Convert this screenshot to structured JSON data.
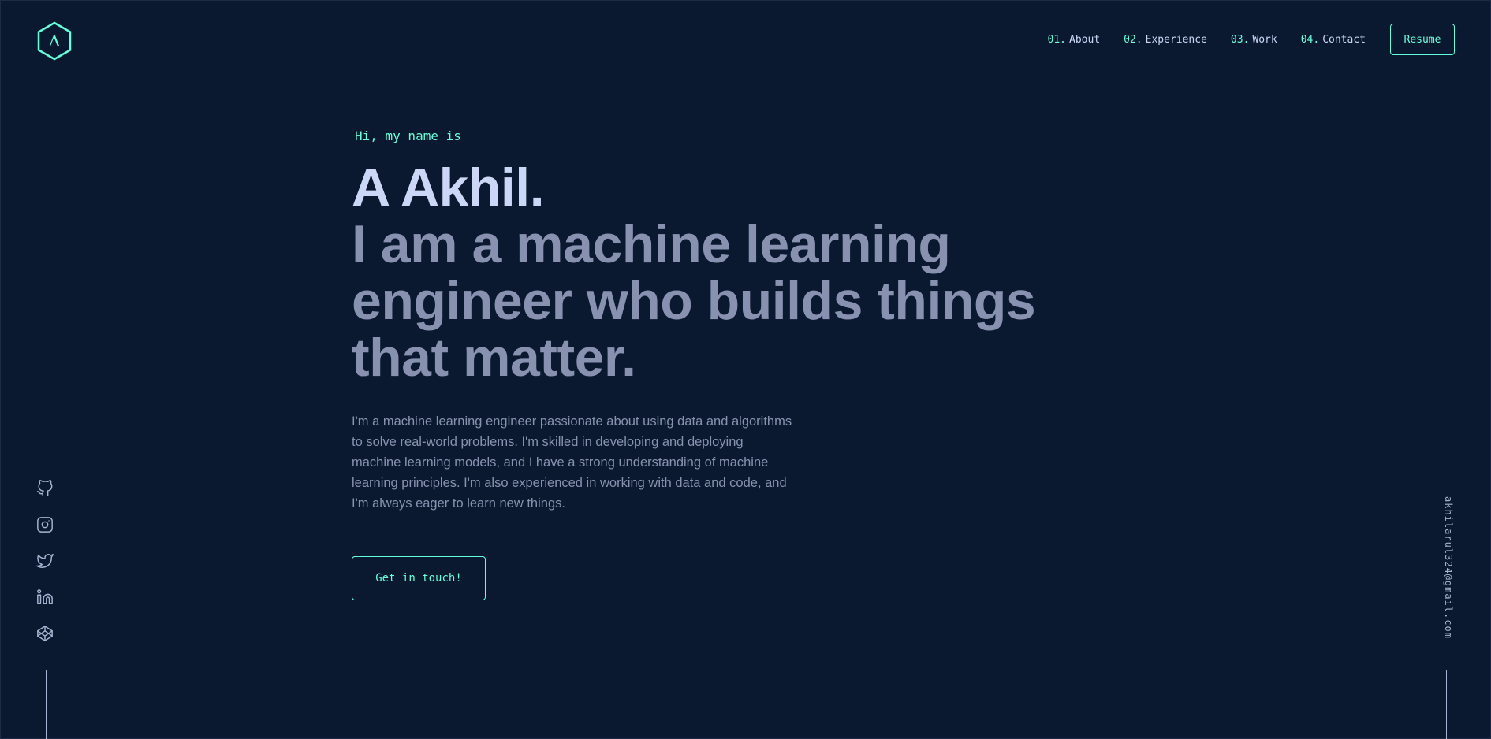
{
  "header": {
    "logo_letter": "A",
    "logo_icon": "hexagon-logo-icon",
    "nav": [
      {
        "num": "01.",
        "label": "About"
      },
      {
        "num": "02.",
        "label": "Experience"
      },
      {
        "num": "03.",
        "label": "Work"
      },
      {
        "num": "04.",
        "label": "Contact"
      }
    ],
    "resume_label": "Resume"
  },
  "hero": {
    "greeting": "Hi, my name is",
    "name": "A Akhil.",
    "tagline": "I am a machine learning engineer who builds things that matter.",
    "bio": "I'm a machine learning engineer passionate about using data and algorithms to solve real-world problems. I'm skilled in developing and deploying machine learning models, and I have a strong understanding of machine learning principles. I'm also experienced in working with data and code, and I'm always eager to learn new things.",
    "cta_label": "Get in touch!"
  },
  "social": [
    {
      "icon": "github-icon"
    },
    {
      "icon": "instagram-icon"
    },
    {
      "icon": "twitter-icon"
    },
    {
      "icon": "linkedin-icon"
    },
    {
      "icon": "codepen-icon"
    }
  ],
  "email": "akhilarul324@gmail.com",
  "colors": {
    "background": "#0a192f",
    "accent": "#64ffda",
    "heading": "#ccd6f6",
    "text": "#8892b0",
    "light": "#a8b2d1"
  }
}
